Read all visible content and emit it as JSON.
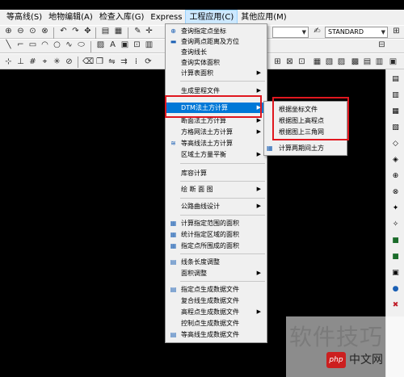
{
  "menubar": {
    "items": [
      {
        "label": "等高线(S)"
      },
      {
        "label": "地物编辑(A)"
      },
      {
        "label": "检查入库(G)"
      },
      {
        "label": "Express"
      },
      {
        "label": "工程应用(C)"
      },
      {
        "label": "其他应用(M)"
      }
    ]
  },
  "toolbar": {
    "style_combo": "STANDARD"
  },
  "dropdown": {
    "items": [
      {
        "label": "查询指定点坐标",
        "icon": "query-point-icon"
      },
      {
        "label": "查询两点距离及方位",
        "icon": "measure-icon"
      },
      {
        "label": "查询线长"
      },
      {
        "label": "查询实体面积"
      },
      {
        "label": "计算表面积",
        "submenu": true
      },
      {
        "label": "生成里程文件",
        "submenu": true
      },
      {
        "label": "DTM法土方计算",
        "submenu": true
      },
      {
        "label": "断面法土方计算",
        "submenu": true
      },
      {
        "label": "方格网法土方计算",
        "submenu": true
      },
      {
        "label": "等高线法土方计算",
        "icon": "contour-icon"
      },
      {
        "label": "区域土方量平衡",
        "submenu": true
      },
      {
        "label": "库容计算"
      },
      {
        "label": "绘 断 面 图",
        "submenu": true
      },
      {
        "label": "公路曲线设计",
        "submenu": true
      },
      {
        "label": "计算指定范围的面积",
        "icon": "area-icon"
      },
      {
        "label": "统计指定区域的面积",
        "icon": "area-icon"
      },
      {
        "label": "指定点所围成的面积",
        "icon": "area-icon"
      },
      {
        "label": "线条长度调整",
        "icon": "line-icon"
      },
      {
        "label": "面积调整",
        "submenu": true
      },
      {
        "label": "指定点生成数据文件",
        "icon": "file-icon"
      },
      {
        "label": "复合线生成数据文件"
      },
      {
        "label": "高程点生成数据文件",
        "submenu": true
      },
      {
        "label": "控制点生成数据文件"
      },
      {
        "label": "等高线生成数据文件",
        "icon": "file-icon"
      }
    ]
  },
  "submenu": {
    "items": [
      {
        "label": "根据坐标文件"
      },
      {
        "label": "根据图上高程点"
      },
      {
        "label": "根据图上三角网"
      },
      {
        "label": "计算两期间土方"
      }
    ]
  },
  "watermark": {
    "text": "软件技巧",
    "badge": "php",
    "site": "中文网"
  },
  "colors": {
    "highlight": "#0078d7",
    "annotation": "#e0171f",
    "canvas": "#000000"
  }
}
